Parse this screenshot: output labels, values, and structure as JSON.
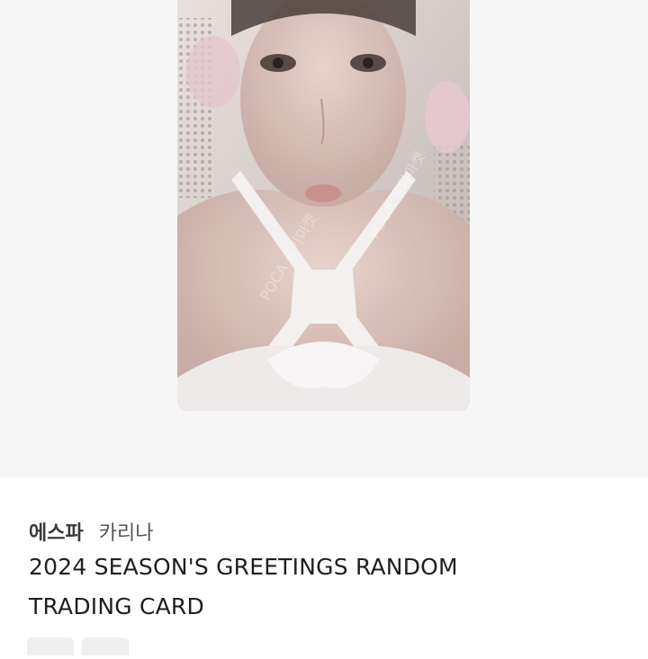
{
  "listing": {
    "artist": "에스파",
    "member": "카리나",
    "title_line1": "2024 SEASON'S GREETINGS RANDOM",
    "title_line2": "TRADING CARD"
  },
  "image": {
    "watermark": "POCA 포카마켓"
  },
  "colors": {
    "hero_bg": "#f6f6f6",
    "text": "#1f1f1f",
    "chip": "#efefef"
  }
}
